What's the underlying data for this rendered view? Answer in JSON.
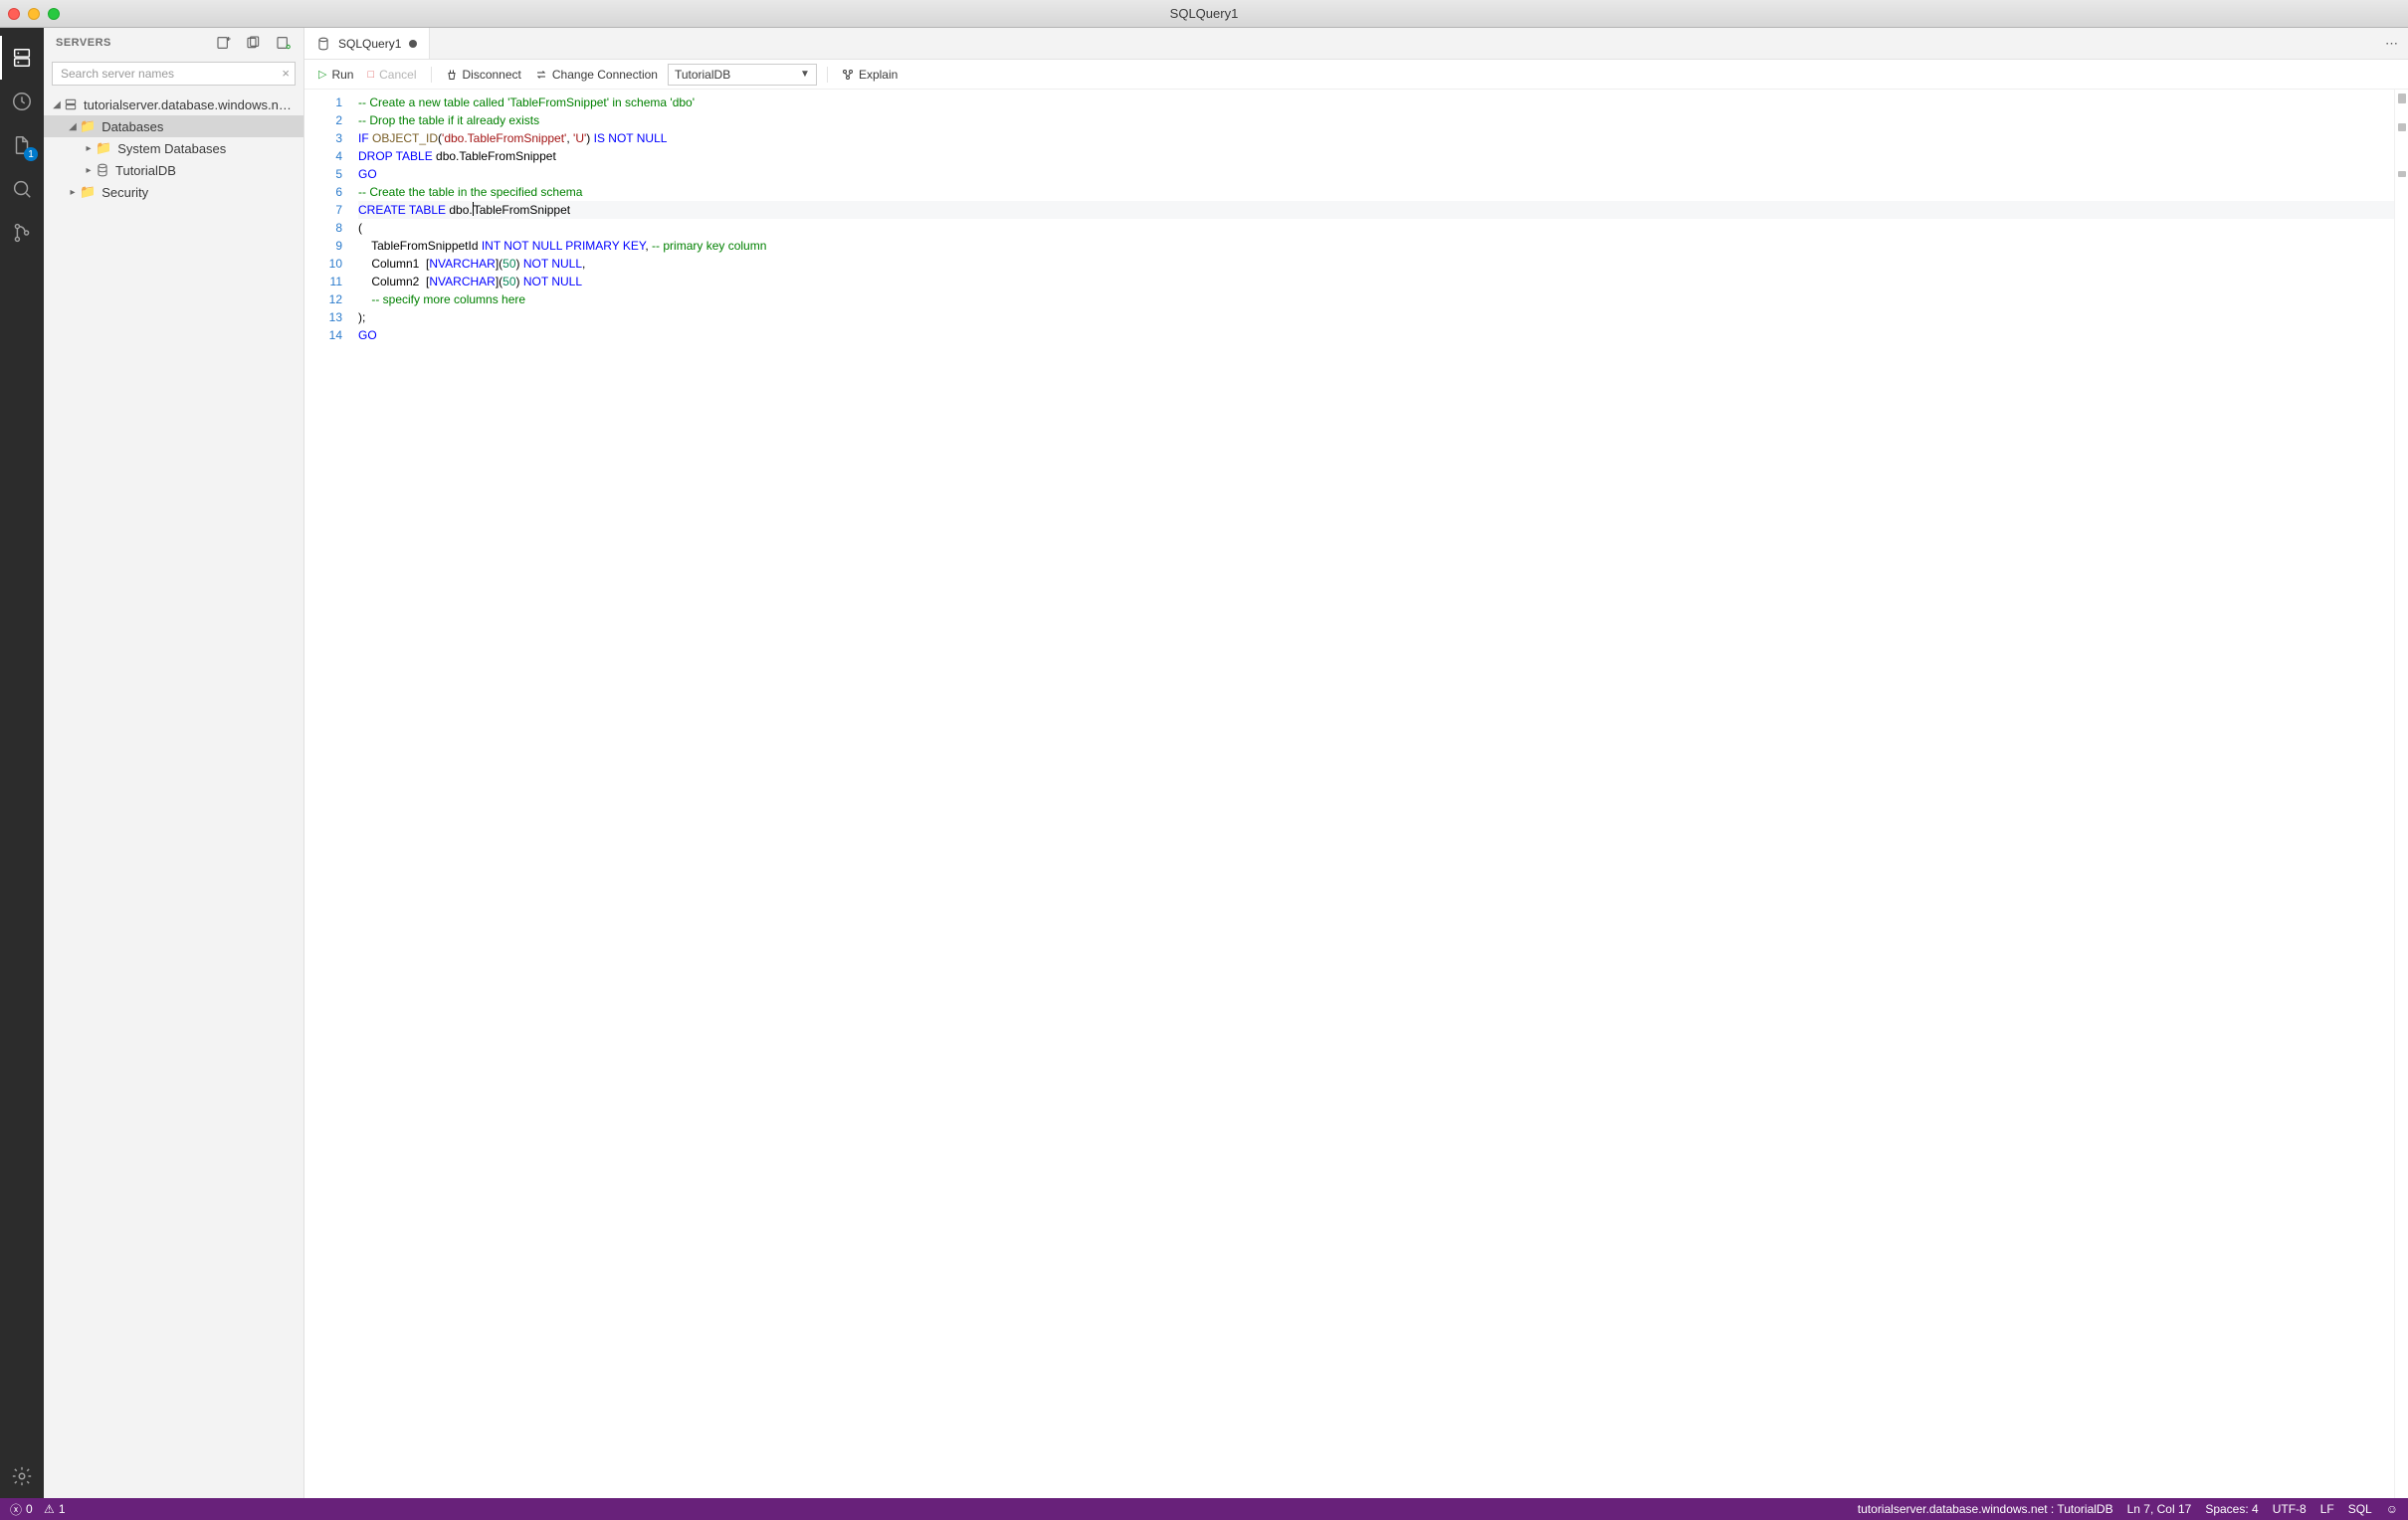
{
  "window": {
    "title": "SQLQuery1"
  },
  "activitybar": {
    "items": [
      {
        "name": "servers",
        "active": true
      },
      {
        "name": "task-history"
      },
      {
        "name": "explorer",
        "badge": "1"
      },
      {
        "name": "search"
      },
      {
        "name": "source-control"
      }
    ],
    "bottom": {
      "name": "manage"
    }
  },
  "sidebar": {
    "title": "SERVERS",
    "search_placeholder": "Search server names",
    "tree": {
      "server": "tutorialserver.database.windows.n…",
      "databases_label": "Databases",
      "system_databases_label": "System Databases",
      "tutorialdb_label": "TutorialDB",
      "security_label": "Security"
    }
  },
  "tabs": {
    "items": [
      {
        "label": "SQLQuery1",
        "dirty": true
      }
    ]
  },
  "toolbar": {
    "run": "Run",
    "cancel": "Cancel",
    "disconnect": "Disconnect",
    "change_connection": "Change Connection",
    "database_selected": "TutorialDB",
    "explain": "Explain"
  },
  "editor": {
    "line_count": 14,
    "current_line": 7,
    "tokens": [
      [
        {
          "t": "-- Create a new table called 'TableFromSnippet' in schema 'dbo'",
          "c": "s-comment"
        }
      ],
      [
        {
          "t": "-- Drop the table if it already exists",
          "c": "s-comment"
        }
      ],
      [
        {
          "t": "IF",
          "c": "s-key"
        },
        {
          "t": " "
        },
        {
          "t": "OBJECT_ID",
          "c": "s-func"
        },
        {
          "t": "("
        },
        {
          "t": "'dbo.TableFromSnippet'",
          "c": "s-str"
        },
        {
          "t": ", "
        },
        {
          "t": "'U'",
          "c": "s-str"
        },
        {
          "t": ")"
        },
        {
          "t": " "
        },
        {
          "t": "IS NOT NULL",
          "c": "s-key"
        }
      ],
      [
        {
          "t": "DROP TABLE",
          "c": "s-key"
        },
        {
          "t": " dbo.TableFromSnippet"
        }
      ],
      [
        {
          "t": "GO",
          "c": "s-go"
        }
      ],
      [
        {
          "t": "-- Create the table in the specified schema",
          "c": "s-comment"
        }
      ],
      [
        {
          "t": "CREATE TABLE",
          "c": "s-key"
        },
        {
          "t": " dbo"
        },
        {
          "t": ".",
          "cursor": true
        },
        {
          "t": "TableFromSnippet"
        }
      ],
      [
        {
          "t": "("
        }
      ],
      [
        {
          "t": "    TableFromSnippetId "
        },
        {
          "t": "INT NOT NULL PRIMARY KEY",
          "c": "s-key"
        },
        {
          "t": ", "
        },
        {
          "t": "-- primary key column",
          "c": "s-comment"
        }
      ],
      [
        {
          "t": "    Column1  ["
        },
        {
          "t": "NVARCHAR",
          "c": "s-key"
        },
        {
          "t": "]("
        },
        {
          "t": "50",
          "c": "s-num"
        },
        {
          "t": ") "
        },
        {
          "t": "NOT NULL",
          "c": "s-key"
        },
        {
          "t": ","
        }
      ],
      [
        {
          "t": "    Column2  ["
        },
        {
          "t": "NVARCHAR",
          "c": "s-key"
        },
        {
          "t": "]("
        },
        {
          "t": "50",
          "c": "s-num"
        },
        {
          "t": ") "
        },
        {
          "t": "NOT NULL",
          "c": "s-key"
        }
      ],
      [
        {
          "t": "    "
        },
        {
          "t": "-- specify more columns here",
          "c": "s-comment"
        }
      ],
      [
        {
          "t": ");"
        }
      ],
      [
        {
          "t": "GO",
          "c": "s-go"
        }
      ]
    ]
  },
  "statusbar": {
    "errors": "0",
    "warnings": "1",
    "connection": "tutorialserver.database.windows.net : TutorialDB",
    "cursor": "Ln 7, Col 17",
    "spaces": "Spaces: 4",
    "encoding": "UTF-8",
    "eol": "LF",
    "language": "SQL"
  }
}
